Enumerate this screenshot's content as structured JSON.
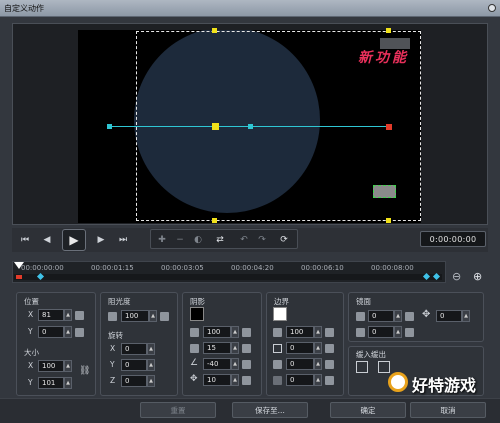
{
  "window": {
    "title": "自定义动作"
  },
  "preview": {
    "caption": "新功能"
  },
  "controls": {
    "timecode": "0:00:00:00"
  },
  "timeline": {
    "ticks": [
      "00:00:00:00",
      "00:00:01:15",
      "00:00:03:05",
      "00:00:04:20",
      "00:00:06:10",
      "00:00:08:00"
    ]
  },
  "properties": {
    "position": {
      "label": "位置",
      "x_label": "X",
      "x": "81",
      "y_label": "Y",
      "y": "0"
    },
    "size": {
      "label": "大小",
      "x_label": "X",
      "x": "100",
      "y_label": "Y",
      "y": "101"
    },
    "opacity": {
      "label": "阻光度",
      "value": "100"
    },
    "rotation": {
      "label": "旋转",
      "x_label": "X",
      "x": "0",
      "y_label": "Y",
      "y": "0",
      "z_label": "Z",
      "z": "0"
    },
    "shadow": {
      "label": "阴影",
      "opacity": "100",
      "blur": "15",
      "angle": "-40",
      "distance": "10"
    },
    "border": {
      "label": "边界",
      "opacity": "100",
      "v1": "0",
      "v2": "0",
      "v3": "0"
    },
    "mirror": {
      "label": "镜面",
      "v1": "0",
      "v2": "0",
      "v3": "0"
    },
    "fade": {
      "label": "缓入缓出"
    }
  },
  "buttons": {
    "reset": "重置",
    "save_as": "保存至...",
    "ok": "确定",
    "cancel": "取消"
  },
  "watermark": "好特游戏"
}
